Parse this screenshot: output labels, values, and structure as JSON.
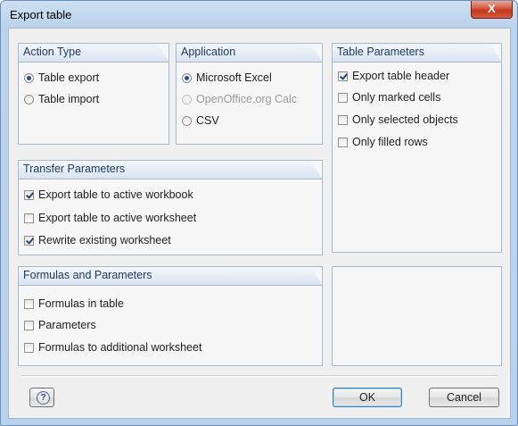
{
  "window": {
    "title": "Export table",
    "close_symbol": "X"
  },
  "action_type": {
    "title": "Action Type",
    "options": [
      {
        "label": "Table export",
        "selected": true
      },
      {
        "label": "Table import",
        "selected": false
      }
    ]
  },
  "application": {
    "title": "Application",
    "options": [
      {
        "label": "Microsoft Excel",
        "selected": true,
        "enabled": true
      },
      {
        "label": "OpenOffice.org Calc",
        "selected": false,
        "enabled": false
      },
      {
        "label": "CSV",
        "selected": false,
        "enabled": true
      }
    ]
  },
  "table_parameters": {
    "title": "Table Parameters",
    "options": [
      {
        "label": "Export table header",
        "checked": true
      },
      {
        "label": "Only marked cells",
        "checked": false
      },
      {
        "label": "Only selected objects",
        "checked": false
      },
      {
        "label": "Only filled rows",
        "checked": false
      }
    ]
  },
  "transfer_parameters": {
    "title": "Transfer Parameters",
    "options": [
      {
        "label": "Export table to active workbook",
        "checked": true
      },
      {
        "label": "Export table to active worksheet",
        "checked": false
      },
      {
        "label": "Rewrite existing worksheet",
        "checked": true
      }
    ]
  },
  "formulas_parameters": {
    "title": "Formulas and Parameters",
    "options": [
      {
        "label": "Formulas in table",
        "checked": false
      },
      {
        "label": "Parameters",
        "checked": false
      },
      {
        "label": "Formulas to additional worksheet",
        "checked": false
      }
    ]
  },
  "buttons": {
    "ok": "OK",
    "cancel": "Cancel",
    "help_icon": "help-icon"
  },
  "colors": {
    "title_bar": "#bcd3ec",
    "close_button": "#c3381f",
    "group_header": "#d9e4f1",
    "group_title_text": "#1e395b"
  }
}
